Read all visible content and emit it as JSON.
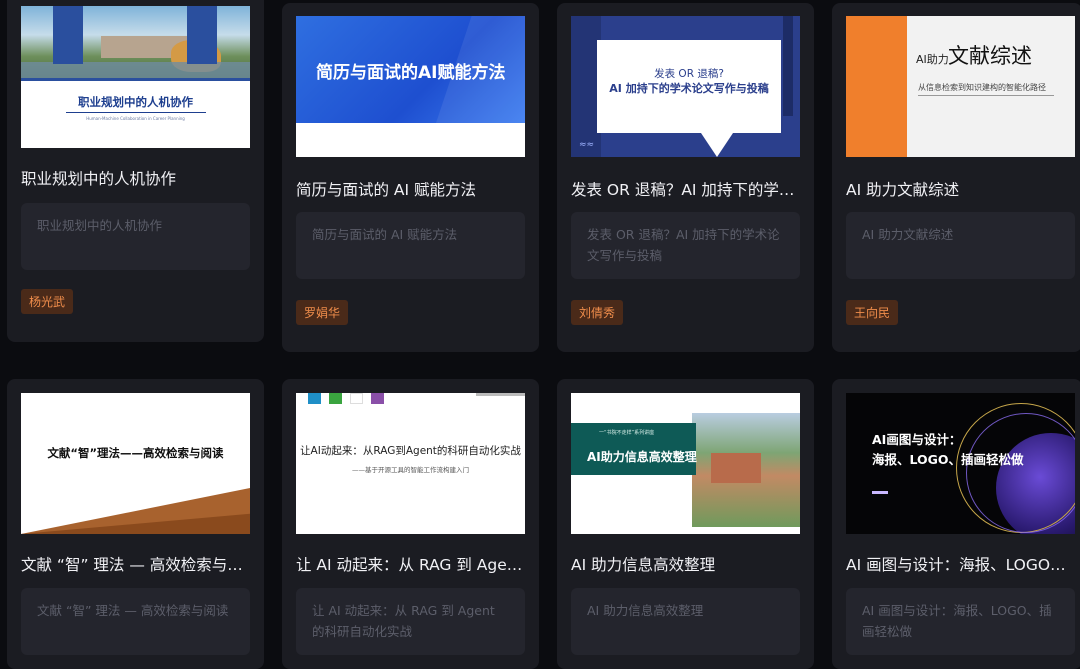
{
  "cards": [
    {
      "title": "职业规划中的人机协作",
      "desc": "职业规划中的人机协作",
      "author": "杨光武",
      "thumb": {
        "headline": "职业规划中的人机协作",
        "subline": "Human-Machine Collaboration in Career Planning"
      }
    },
    {
      "title": "简历与面试的 AI 赋能方法",
      "desc": "简历与面试的 AI 赋能方法",
      "author": "罗娟华",
      "thumb": {
        "headline": "简历与面试的AI赋能方法"
      }
    },
    {
      "title": "发表 OR 退稿？AI 加持下的学…",
      "desc": "发表 OR 退稿？AI 加持下的学术论文写作与投稿",
      "author": "刘倩秀",
      "thumb": {
        "line1": "发表 OR 退稿?",
        "line2": "AI 加持下的学术论文写作与投稿"
      }
    },
    {
      "title": "AI 助力文献综述",
      "desc": "AI 助力文献综述",
      "author": "王向民",
      "thumb": {
        "prefix": "AI助力",
        "big": "文献综述",
        "sub": "从信息检索到知识建构的智能化路径"
      }
    },
    {
      "title": "文献 “智” 理法 — 高效检索与阅读",
      "desc": "文献 “智” 理法 — 高效检索与阅读",
      "thumb": {
        "headline": "文献“智”理法——高效检索与阅读"
      }
    },
    {
      "title": "让 AI 动起来：从 RAG 到 Agent…",
      "desc": "让 AI 动起来：从 RAG 到 Agent 的科研自动化实战",
      "thumb": {
        "headline": "让AI动起来：从RAG到Agent的科研自动化实战",
        "sub": "——基于开源工具的智能工作流构建入门"
      }
    },
    {
      "title": "AI 助力信息高效整理",
      "desc": "AI 助力信息高效整理",
      "thumb": {
        "top": "一“书院不走样”系列讲座",
        "headline": "AI助力信息高效整理"
      }
    },
    {
      "title": "AI 画图与设计：海报、LOGO、…",
      "desc": "AI 画图与设计：海报、LOGO、插画轻松做",
      "thumb": {
        "line1": "AI画图与设计：",
        "line2": "海报、LOGO、插画轻松做"
      }
    }
  ]
}
